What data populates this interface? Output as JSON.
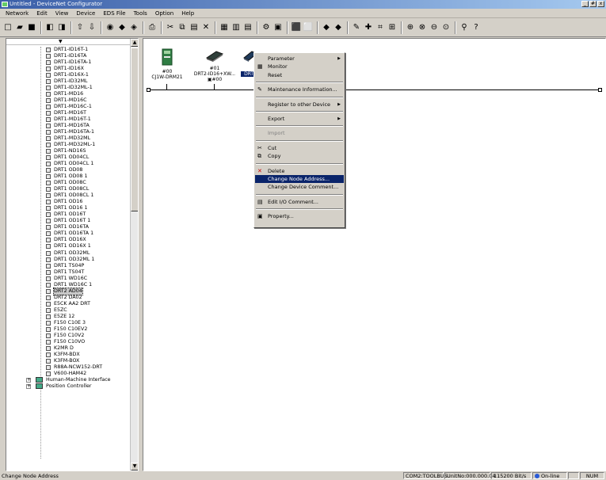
{
  "window": {
    "title": "Untitled - DeviceNet Configurator",
    "controls": [
      "_",
      "#",
      "x"
    ]
  },
  "menubar": [
    "Network",
    "Edit",
    "View",
    "Device",
    "EDS File",
    "Tools",
    "Option",
    "Help"
  ],
  "toolbar": {
    "buttons": [
      {
        "name": "new-icon",
        "glyph": "□"
      },
      {
        "name": "open-icon",
        "glyph": "▰"
      },
      {
        "name": "save-icon",
        "glyph": "■"
      },
      {
        "sep": true
      },
      {
        "name": "online-icon",
        "glyph": "◧"
      },
      {
        "name": "offline-icon",
        "glyph": "◨"
      },
      {
        "sep": true
      },
      {
        "name": "upload-icon",
        "glyph": "⇧"
      },
      {
        "name": "download-icon",
        "glyph": "⇩"
      },
      {
        "sep": true
      },
      {
        "name": "monitor-icon",
        "glyph": "◉"
      },
      {
        "name": "connect-icon",
        "glyph": "◆"
      },
      {
        "name": "disconnect-icon",
        "glyph": "◈"
      },
      {
        "sep": true
      },
      {
        "name": "print-icon",
        "glyph": "⎙"
      },
      {
        "sep": true
      },
      {
        "name": "cut-icon",
        "glyph": "✂"
      },
      {
        "name": "copy-icon",
        "glyph": "⧉"
      },
      {
        "name": "paste-icon",
        "glyph": "▤"
      },
      {
        "name": "delete-icon",
        "glyph": "✕"
      },
      {
        "sep": true
      },
      {
        "name": "large-icons-icon",
        "glyph": "▦"
      },
      {
        "name": "small-icons-icon",
        "glyph": "▥"
      },
      {
        "name": "list-icon",
        "glyph": "▤"
      },
      {
        "sep": true
      },
      {
        "name": "properties-icon",
        "glyph": "⚙"
      },
      {
        "name": "parameter-icon",
        "glyph": "▣"
      },
      {
        "sep": true
      },
      {
        "name": "read-icon",
        "glyph": "⬛"
      },
      {
        "name": "write-icon",
        "glyph": "⬜"
      },
      {
        "sep": true
      },
      {
        "name": "up-icon",
        "glyph": "◆"
      },
      {
        "name": "down-icon",
        "glyph": "◆"
      },
      {
        "sep": true
      },
      {
        "name": "maintenance-icon",
        "glyph": "✎"
      },
      {
        "name": "reg-device-icon",
        "glyph": "✚"
      },
      {
        "name": "network-config-icon",
        "glyph": "⌗"
      },
      {
        "name": "master-param-icon",
        "glyph": "⊞"
      },
      {
        "sep": true
      },
      {
        "name": "eds-install-icon",
        "glyph": "⊕"
      },
      {
        "name": "eds-create-icon",
        "glyph": "⊗"
      },
      {
        "name": "eds-delete-icon",
        "glyph": "⊖"
      },
      {
        "name": "monitor2-icon",
        "glyph": "⊙"
      },
      {
        "sep": true
      },
      {
        "name": "find-icon",
        "glyph": "⚲"
      },
      {
        "name": "help-icon",
        "glyph": "?"
      }
    ]
  },
  "tree": {
    "items": [
      "DRT1-ID16T-1",
      "DRT1-ID16TA",
      "DRT1-ID16TA-1",
      "DRT1-ID16X",
      "DRT1-ID16X-1",
      "DRT1-ID32ML",
      "DRT1-ID32ML-1",
      "DRT1-MD16",
      "DRT1-MD16C",
      "DRT1-MD16C-1",
      "DRT1-MD16T",
      "DRT1-MD16T-1",
      "DRT1-MD16TA",
      "DRT1-MD16TA-1",
      "DRT1-MD32ML",
      "DRT1-MD32ML-1",
      "DRT1-ND16S",
      "DRT1 OD04CL",
      "DRT1 OD04CL 1",
      "DRT1 OD08",
      "DRT1 OD08 1",
      "DRT1 OD08C",
      "DRT1 OD08CL",
      "DRT1 OD08CL 1",
      "DRT1 OD16",
      "DRT1 OD16 1",
      "DRT1 OD16T",
      "DRT1 OD16T 1",
      "DRT1 OD16TA",
      "DRT1 OD16TA 1",
      "DRT1 OD16X",
      "DRT1 OD16X 1",
      "DRT1 OD32ML",
      "DRT1 OD32ML 1",
      "DRT1 TS04P",
      "DRT1 TS04T",
      "DRT1 WD16C",
      "DRT1 WD16C 1",
      "DRT2 AD04",
      "DRT2 DA02",
      "E5CK AA2 DRT",
      "E5ZC",
      "E5ZE 12",
      "F150 C10E 3",
      "F150 C10EV2",
      "F150 C10V2",
      "F150 C10VO",
      "K2MR D",
      "K3FM-BDX",
      "K3FM-BOX",
      "R88A-NCW152-DRT",
      "V600-HAM42"
    ],
    "selected_index": 38,
    "groups": [
      "Human-Machine Interface",
      "Position Controller"
    ],
    "scroll_position": 0.4
  },
  "network": {
    "nodes": [
      {
        "address": "#00",
        "model": "CJ1W-DRM21",
        "color": "#2f7d43"
      },
      {
        "address": "#01",
        "model": "DRT2-ID16+XW...",
        "sub": "#00",
        "color": "#2f3f3a"
      },
      {
        "address": "",
        "model": "DRT2",
        "color": "#1f3a5a"
      }
    ]
  },
  "context_menu": {
    "items": [
      {
        "label": "Parameter",
        "submenu": true
      },
      {
        "label": "Monitor",
        "icon": "monitor-icon",
        "glyph": "▦"
      },
      {
        "label": "Reset"
      },
      {
        "sep": true
      },
      {
        "label": "Maintenance Information...",
        "icon": "maintenance-icon",
        "glyph": "✎"
      },
      {
        "sep": true
      },
      {
        "label": "Register to other Device",
        "submenu": true
      },
      {
        "sep": true
      },
      {
        "label": "Export",
        "submenu": true
      },
      {
        "sep": true
      },
      {
        "label": "Import",
        "disabled": true
      },
      {
        "sep": true
      },
      {
        "label": "Cut",
        "icon": "cut-icon",
        "glyph": "✂"
      },
      {
        "label": "Copy",
        "icon": "copy-icon",
        "glyph": "⧉"
      },
      {
        "sep": true
      },
      {
        "label": "Delete",
        "icon": "delete-icon",
        "glyph": "✕"
      },
      {
        "label": "Change Node Address...",
        "highlighted": true
      },
      {
        "label": "Change Device Comment..."
      },
      {
        "sep": true
      },
      {
        "label": "Edit I/O Comment...",
        "icon": "io-comment-icon",
        "glyph": "▤"
      },
      {
        "sep": true
      },
      {
        "label": "Property...",
        "icon": "property-icon",
        "glyph": "▣"
      }
    ]
  },
  "statusbar": {
    "message": "Change Node Address",
    "port": "COM2:TOOLBUS",
    "unit": "UnitNo:000.000.04",
    "baud": "115200 Bit/s",
    "mode": "On-line",
    "num": "NUM"
  }
}
